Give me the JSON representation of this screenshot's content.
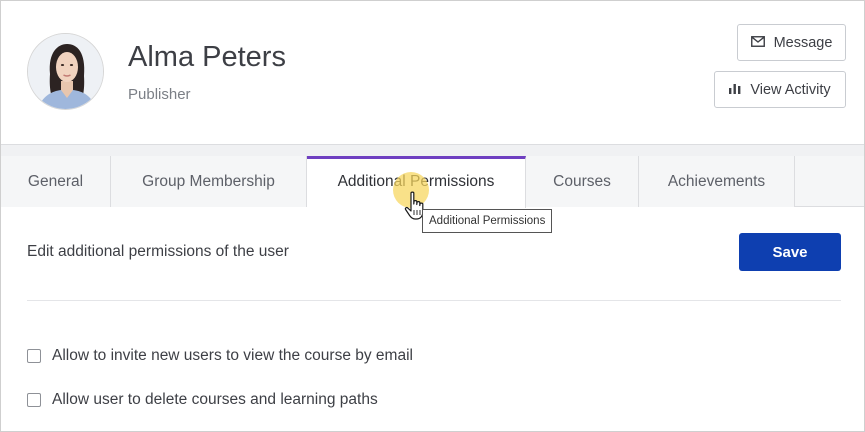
{
  "profile": {
    "name": "Alma Peters",
    "role": "Publisher"
  },
  "actions": {
    "message_label": "Message",
    "message_icon": "envelope-icon",
    "activity_label": "View Activity",
    "activity_icon": "bar-chart-icon"
  },
  "tabs": [
    {
      "label": "General",
      "active": false
    },
    {
      "label": "Group Membership",
      "active": false
    },
    {
      "label": "Additional Permissions",
      "active": true
    },
    {
      "label": "Courses",
      "active": false
    },
    {
      "label": "Achievements",
      "active": false
    }
  ],
  "tooltip": "Additional Permissions",
  "content": {
    "description": "Edit additional permissions of the user",
    "save_label": "Save",
    "permissions": [
      {
        "label": "Allow to invite new users to view the course by email",
        "checked": false
      },
      {
        "label": "Allow user to delete courses and learning paths",
        "checked": false
      }
    ]
  },
  "colors": {
    "accent_tab": "#6f3fc1",
    "primary_button": "#0e3fb0",
    "cursor_halo": "#f7d65c"
  }
}
